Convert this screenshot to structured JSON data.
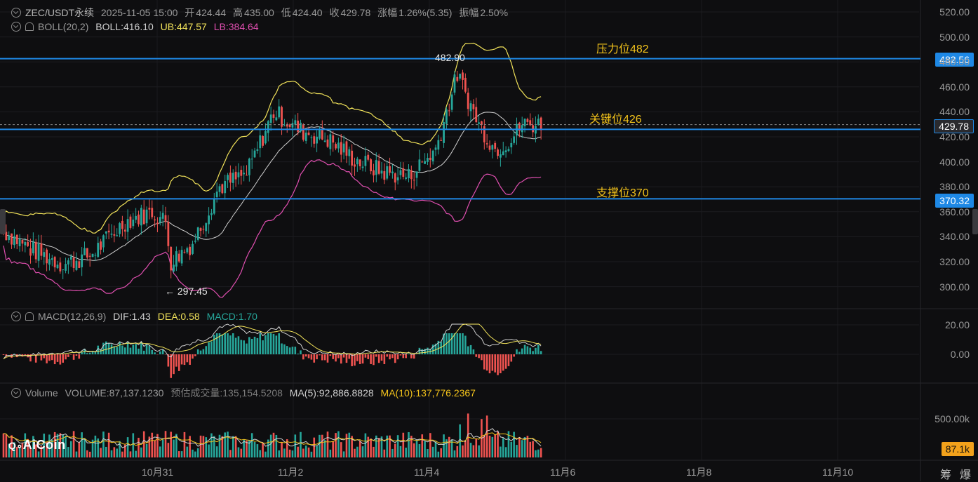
{
  "header": {
    "symbol": "ZEC/USDT永续",
    "datetime": "2025-11-05 15:00",
    "open_label": "开",
    "open": "424.44",
    "high_label": "高",
    "high": "435.00",
    "low_label": "低",
    "low": "424.40",
    "close_label": "收",
    "close": "429.78",
    "change_label": "涨幅",
    "change": "1.26%(5.35)",
    "amp_label": "振幅",
    "amp": "2.50%"
  },
  "boll": {
    "name": "BOLL(20,2)",
    "mid": "BOLL:416.10",
    "ub": "UB:447.57",
    "lb": "LB:384.64"
  },
  "macd": {
    "name": "MACD(12,26,9)",
    "dif": "DIF:1.43",
    "dea": "DEA:0.58",
    "macd": "MACD:1.70"
  },
  "volume": {
    "name": "Volume",
    "vol": "VOLUME:87,137.1230",
    "est": "预估成交量:135,154.5208",
    "ma5": "MA(5):92,886.8828",
    "ma10": "MA(10):137,776.2367"
  },
  "levels": {
    "resistance": {
      "label": "压力位482",
      "tag": "482.56",
      "value": 482.56
    },
    "key": {
      "label": "关键位426",
      "tag": "429.78",
      "value": 426
    },
    "support": {
      "label": "支撑位370",
      "tag": "370.32",
      "value": 370.32
    }
  },
  "annotations": {
    "high": "482.90",
    "low": "297.45",
    "low_arrow": "←"
  },
  "price_axis": [
    "520.00",
    "500.00",
    "480.00",
    "460.00",
    "440.00",
    "420.00",
    "400.00",
    "380.00",
    "360.00",
    "340.00",
    "320.00",
    "300.00"
  ],
  "macd_axis": [
    "20.00",
    "0.00"
  ],
  "volume_axis": [
    "500.00k"
  ],
  "volume_tag": "87.1k",
  "time_axis": [
    "10月31",
    "11月2",
    "11月4",
    "11月6",
    "11月8",
    "11月10"
  ],
  "toolbar": {
    "tool1": "筹",
    "tool2": "爆"
  },
  "logo": "AiCoin",
  "colors": {
    "up": "#26a69a",
    "down": "#ef5350",
    "boll_mid": "#d0d0d0",
    "boll_ub": "#f2e35a",
    "boll_lb": "#e04fb0",
    "level": "#1e88e5",
    "dif": "#d0d0d0",
    "dea": "#f2e35a",
    "ma5": "#d0d0d0",
    "ma10": "#f2c21b"
  }
}
